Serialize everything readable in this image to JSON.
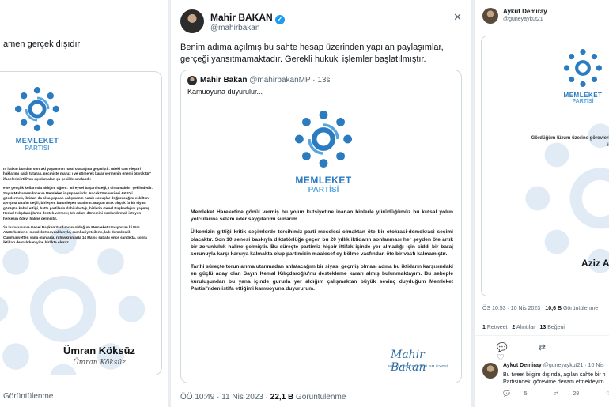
{
  "left": {
    "header": "amen gerçek dışıdır",
    "logo": {
      "name": "MEMLEKET",
      "sub": "PARTİSİ"
    },
    "paragraphs": [
      "n, halkın bundan sonraki yaşamının nasıl olacağına geçmiştir. ndeki tüm eleştiri haklarımı saklı tutarak, geçmişte maruz ı ve gömerek karar vermenin önemi büyüktür\" ifadelerini rtili'nın açıklamaları şu şekilde sıralandı:",
      "e ve gençlik kollarında aldığım öğreti: 'Bireysel başarı isteği, ı olmamalıdır' şeklindedir. Sayın Muharrem İnce ve Memleket ir şüphesizdir. Ancak tüm verileri AKP'yi göndermek, iktidarı da olsa yapılan çalışmanın hatalı sonuçlar doğuracağını eskilten, ayrışma tarafın değil; birleşen, bütünleşen tarafın n. Bugün artık birçok farklı siyasi görüşün kabul ettiği, hatta partilerin dahi ulaştığı, bizlerin Genel Başkanlığını yapmış Kemal Kılıçdaroğlu'nu destek vermek; tek adam dönemini sonlandırmak isteyen herkesin ödevi haline gelmiştir.",
      "'in kurucusu ve Genel Başkan Yardımcısı olduğum Memleket Umuyorum ki tüm Atatürkçülerle, memleket sevdalılarıyla, cumhuriyetçilerle, laik demokratik Cumhuriyetten yana olanlarla, ruhaykranlarla 14 Mayıs sabahı önce sandıkta, sonra iktidarı devralırken yine birlikte oluruz."
    ],
    "signature": "Ümran Köksüz",
    "handwritten": "Ümran Köksüz",
    "views": "Görüntülenme"
  },
  "mid": {
    "author": "Mahir BAKAN",
    "verified_glyph": "✓",
    "handle": "@mahirbakan",
    "close_glyph": "✕",
    "text": "Benim adıma açılmış bu sahte hesap üzerinden yapılan paylaşımlar, gerçeği yansıtmamaktadır. Gerekli hukuki işlemler başlatılmıştır.",
    "quote": {
      "author": "Mahir Bakan",
      "handle_time": "@mahirbakanMP · 13s",
      "subtitle": "Kamuoyuna duyurulur...",
      "logo": {
        "name": "MEMLEKET",
        "sub": "PARTİSİ"
      },
      "paragraphs": [
        "Memleket Hareketine gönül vermiş bu yolun kutsiyetine inanan binlerle yürüdüğümüz bu kutsal yolun yolcularına selam eder saygılarımı sunarım.",
        "Ülkemizin gittiği kritik seçimlerde tercihimiz parti meselesi olmaktan öte bir otokrasi-demokrasi seçimi olacaktır. Son 10 senesi baskıyla diktatörlüğe geçen bu 20 yıllık iktidarın sonlanması her şeyden öte artık bir zorunluluk haline gelmiştir. Bu süreçte partimiz hiçbir ittifak içinde yer almadığı için ciddi bir baraj sorunuyla karşı karşıya kalmakta olup partimizin maalesef oy bölme vasfından öte bir vasfı kalmamıştır.",
        "Tarihi süreçte torunlarıma utanmadan anlatacağım bir siyasi geçmiş olması adına bu iktidarın karşısındaki en güçlü aday olan Sayın Kemal Kılıçdaroğlu'nu destekleme kararı almış bulunmaktayım. Bu sebeple kuruluşundan bu yana içinde gururla yer aldığım çalışmaktan büyük sevinç duyduğum Memleket Partisi'nden istifa ettiğimi kamuoyuna duyururum."
      ],
      "signature": "Mahir Bakan",
      "signature_sub": "MEMLEKET PARTİSİ PM ÜYESİ"
    },
    "meta_time": "ÖÖ 10:49 · 11 Nis 2023 · ",
    "meta_views_count": "22,1 B",
    "meta_views_label": " Görüntülenme"
  },
  "right": {
    "author": "Aykut Demiray",
    "handle": "@guneyaykut21",
    "logo": {
      "name": "MEMLEKET",
      "sub": "PARTİSİ"
    },
    "card_text": "Gördüğüm lüzum üzerine görevlerimden istifa e",
    "signature": "Aziz A",
    "time": "ÖS 10:53 · 10 Nis 2023 · ",
    "views_count": "10,6 B",
    "views_label": " Görüntülenme",
    "stats": [
      {
        "count": "1",
        "label": "Retweet"
      },
      {
        "count": "2",
        "label": "Alıntılar"
      },
      {
        "count": "13",
        "label": "Beğeni"
      }
    ],
    "action_glyphs": [
      "💬",
      "⇄",
      "♡"
    ],
    "reply": {
      "author": "Aykut Demiray",
      "handle_time": "@guneyaykut21 · 10 Nis",
      "text_line1": "Bu tweet bilgim dışında, açılan sahte bir h",
      "text_line2": "Partisindeki görevime devam etmekteyim",
      "actions": [
        {
          "glyph": "💬",
          "count": "5"
        },
        {
          "glyph": "⇄",
          "count": "28"
        },
        {
          "glyph": "♡",
          "count": "104"
        }
      ]
    }
  },
  "colors": {
    "brand_blue": "#2b7bc0",
    "brand_light": "#58a6e0",
    "twitter_blue": "#1d9bf0",
    "muted": "#536471"
  }
}
